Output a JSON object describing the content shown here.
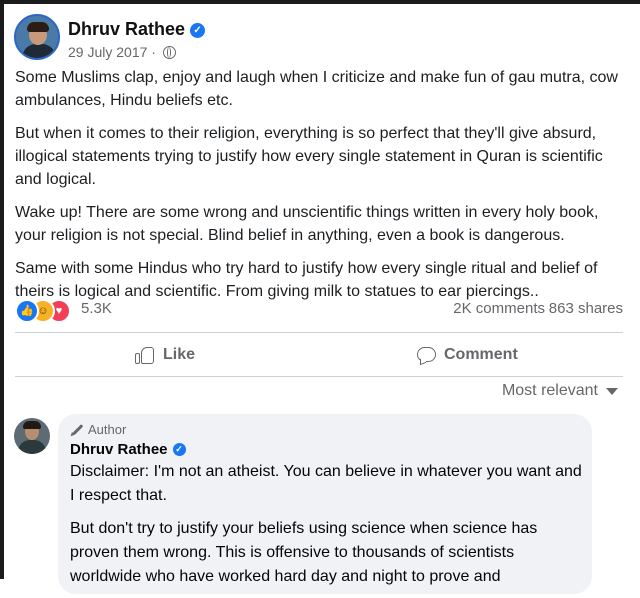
{
  "post": {
    "author": "Dhruv Rathee",
    "date": "29 July 2017",
    "separator": "·",
    "paragraphs": [
      "Some Muslims clap, enjoy and laugh when I criticize and make fun of gau mutra, cow ambulances, Hindu beliefs etc.",
      "But when it comes to their religion, everything is so perfect that they'll give absurd, illogical statements trying to justify how every single statement in Quran is scientific and logical.",
      "Wake up! There are some wrong and unscientific things written in every holy book, your religion is not special. Blind belief in anything, even a book is dangerous.",
      "Same with some Hindus who try hard to justify how every single ritual and belief of theirs is logical and scientific. From giving milk to statues to ear piercings.."
    ]
  },
  "reactions": {
    "icons": [
      "like-icon",
      "haha-icon",
      "love-icon"
    ],
    "count": "5.3K",
    "comments": "2K comments",
    "shares": "863 shares"
  },
  "actions": {
    "like": "Like",
    "comment": "Comment"
  },
  "sort": {
    "label": "Most relevant"
  },
  "comment": {
    "badge": "Author",
    "author": "Dhruv Rathee",
    "paragraphs": [
      "Disclaimer: I'm not an atheist. You can believe in whatever you want and I respect that.",
      "But don't try to justify your beliefs using science when science has proven them wrong. This is offensive to thousands of scientists worldwide who have worked hard day and night to prove and"
    ]
  },
  "colors": {
    "facebook_blue": "#1877f2",
    "secondary_text": "#65676b",
    "bubble_bg": "#f0f2f5"
  }
}
